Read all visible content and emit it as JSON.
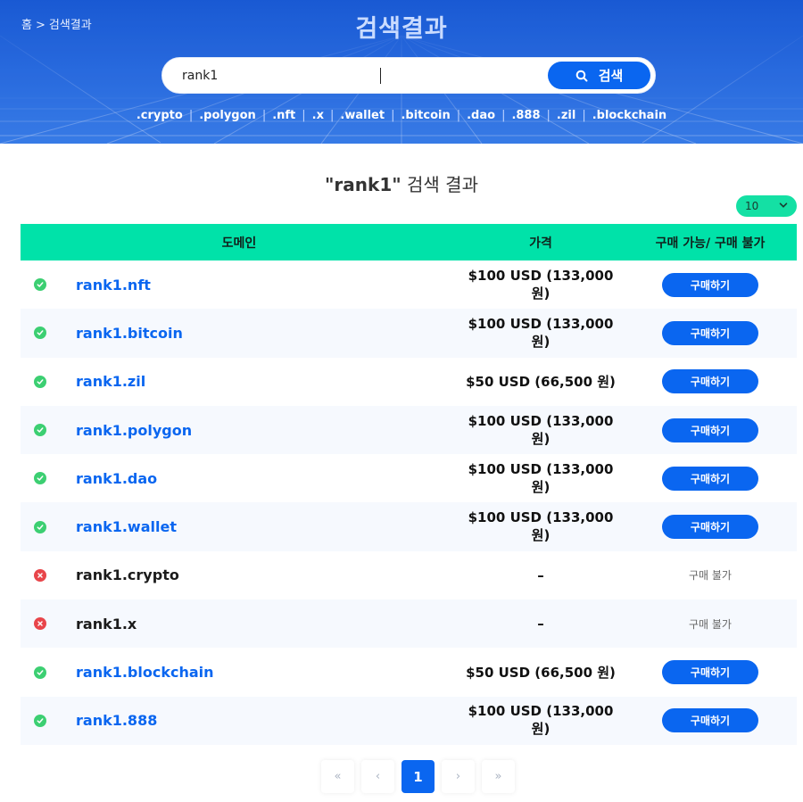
{
  "header": {
    "breadcrumb": [
      "홈",
      ">",
      "검색결과"
    ],
    "title": "검색결과",
    "search_value": "rank1",
    "search_button_label": "검색",
    "tlds": [
      ".crypto",
      ".polygon",
      ".nft",
      ".x",
      ".wallet",
      ".bitcoin",
      ".dao",
      ".888",
      ".zil",
      ".blockchain"
    ]
  },
  "results": {
    "query_quoted": "\"rank1\"",
    "heading_suffix": " 검색 결과",
    "page_size": "10",
    "columns": {
      "domain": "도메인",
      "price": "가격",
      "buy": "구매 가능/ 구매 불가"
    },
    "rows": [
      {
        "domain": "rank1.nft",
        "price": "$100 USD (133,000 원)",
        "action": "구매하기",
        "available": true
      },
      {
        "domain": "rank1.bitcoin",
        "price": "$100 USD (133,000 원)",
        "action": "구매하기",
        "available": true
      },
      {
        "domain": "rank1.zil",
        "price": "$50 USD (66,500 원)",
        "action": "구매하기",
        "available": true
      },
      {
        "domain": "rank1.polygon",
        "price": "$100 USD (133,000 원)",
        "action": "구매하기",
        "available": true
      },
      {
        "domain": "rank1.dao",
        "price": "$100 USD (133,000 원)",
        "action": "구매하기",
        "available": true
      },
      {
        "domain": "rank1.wallet",
        "price": "$100 USD (133,000 원)",
        "action": "구매하기",
        "available": true
      },
      {
        "domain": "rank1.crypto",
        "price": "–",
        "action": "구매 불가",
        "available": false
      },
      {
        "domain": "rank1.x",
        "price": "–",
        "action": "구매 불가",
        "available": false
      },
      {
        "domain": "rank1.blockchain",
        "price": "$50 USD (66,500 원)",
        "action": "구매하기",
        "available": true
      },
      {
        "domain": "rank1.888",
        "price": "$100 USD (133,000 원)",
        "action": "구매하기",
        "available": true
      }
    ]
  },
  "pagination": {
    "first": "«",
    "prev": "‹",
    "current": "1",
    "next": "›",
    "last": "»"
  },
  "colors": {
    "brand_blue": "#0a66f0",
    "table_header": "#00e2a9",
    "available": "#3ccf72",
    "unavailable": "#e8454a"
  }
}
